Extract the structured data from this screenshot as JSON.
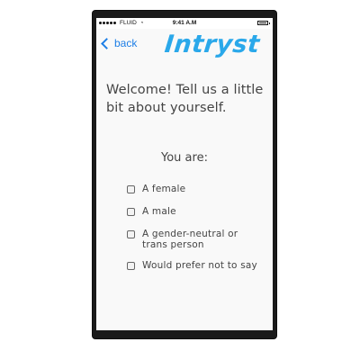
{
  "status_bar": {
    "carrier": "FLUID",
    "time": "9:41 A.M"
  },
  "nav": {
    "back_label": "back",
    "brand": "Intryst"
  },
  "welcome": {
    "heading": "Welcome! Tell us a little bit about yourself."
  },
  "question": {
    "label": "You are:"
  },
  "options": [
    {
      "label": "A female",
      "checked": false
    },
    {
      "label": "A male",
      "checked": false
    },
    {
      "label": "A gender-neutral or trans person",
      "checked": false
    },
    {
      "label": "Would prefer not to say",
      "checked": false
    }
  ],
  "colors": {
    "accent": "#1e7fe6",
    "brand": "#2aa8ea",
    "text": "#444444",
    "phone_frame": "#1a1a1a"
  }
}
